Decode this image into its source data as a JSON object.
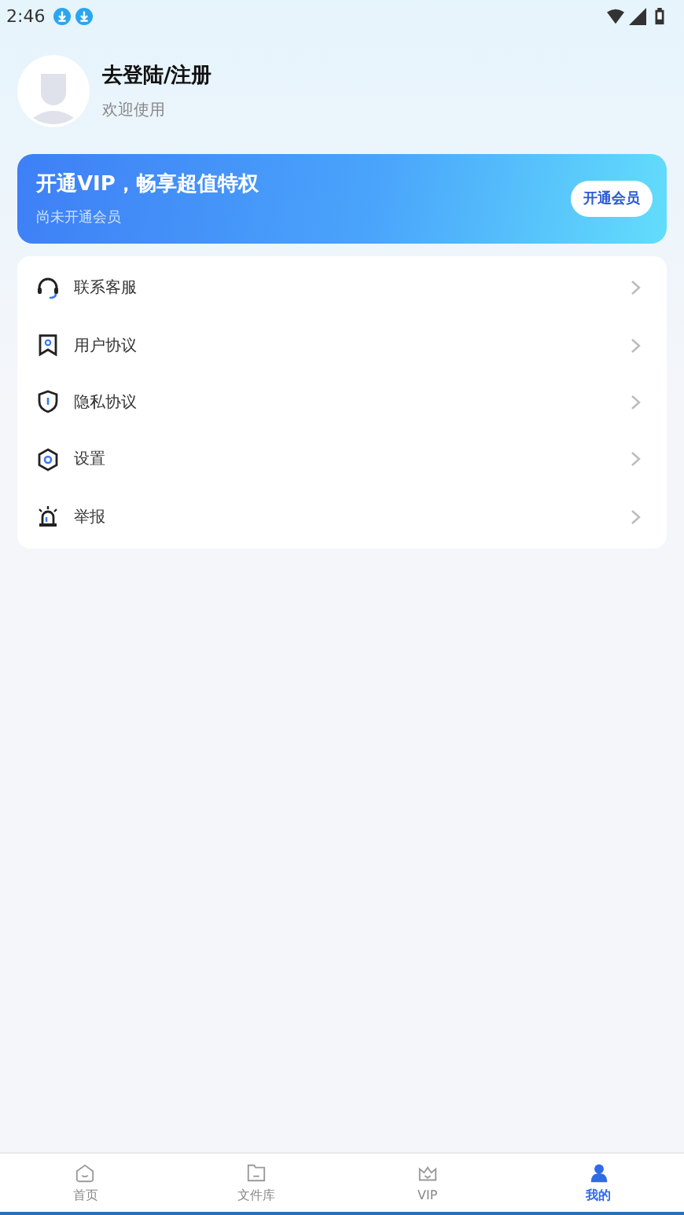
{
  "status_bar": {
    "time": "2:46"
  },
  "profile": {
    "title": "去登陆/注册",
    "subtitle": "欢迎使用"
  },
  "vip_banner": {
    "title": "开通VIP，畅享超值特权",
    "subtitle": "尚未开通会员",
    "button": "开通会员"
  },
  "menu": [
    {
      "kind": "support",
      "label": "联系客服"
    },
    {
      "kind": "agreement",
      "label": "用户协议"
    },
    {
      "kind": "privacy",
      "label": "隐私协议"
    },
    {
      "kind": "settings",
      "label": "设置"
    },
    {
      "kind": "report",
      "label": "举报"
    }
  ],
  "tabs": [
    {
      "kind": "home",
      "label": "首页",
      "selected": false
    },
    {
      "kind": "files",
      "label": "文件库",
      "selected": false
    },
    {
      "kind": "vip",
      "label": "VIP",
      "selected": false
    },
    {
      "kind": "me",
      "label": "我的",
      "selected": true
    }
  ]
}
